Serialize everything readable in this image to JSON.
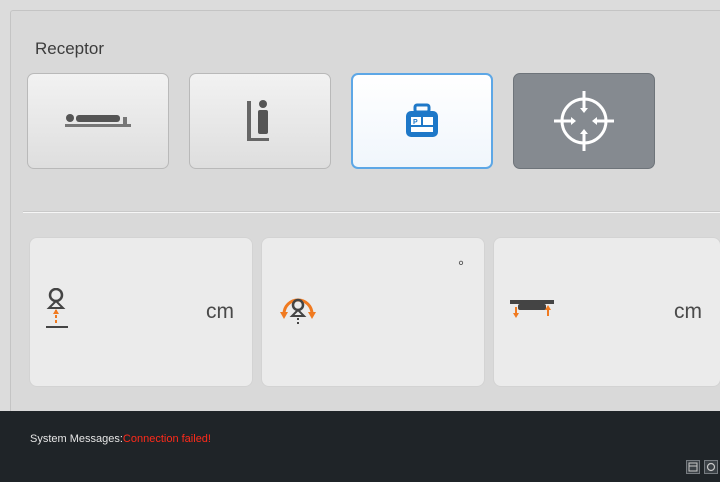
{
  "receptor": {
    "title": "Receptor",
    "buttons": [
      {
        "id": "table",
        "icon": "patient-table-icon",
        "state": "normal"
      },
      {
        "id": "wall-stand",
        "icon": "wall-stand-icon",
        "state": "normal"
      },
      {
        "id": "portable-detector",
        "icon": "portable-detector-icon",
        "state": "selected"
      },
      {
        "id": "target",
        "icon": "crosshair-target-icon",
        "state": "active"
      }
    ]
  },
  "params": [
    {
      "icon": "sid-distance-icon",
      "unit": "cm"
    },
    {
      "icon": "tube-rotation-icon",
      "unit": "°"
    },
    {
      "icon": "table-height-icon",
      "unit": "cm"
    }
  ],
  "status": {
    "label": "System Messages:",
    "message": "Connection failed!"
  },
  "colors": {
    "accent": "#f07a20",
    "selected_border": "#5da7e6",
    "detector_blue": "#1e78c8",
    "error": "#ff2a1a"
  }
}
